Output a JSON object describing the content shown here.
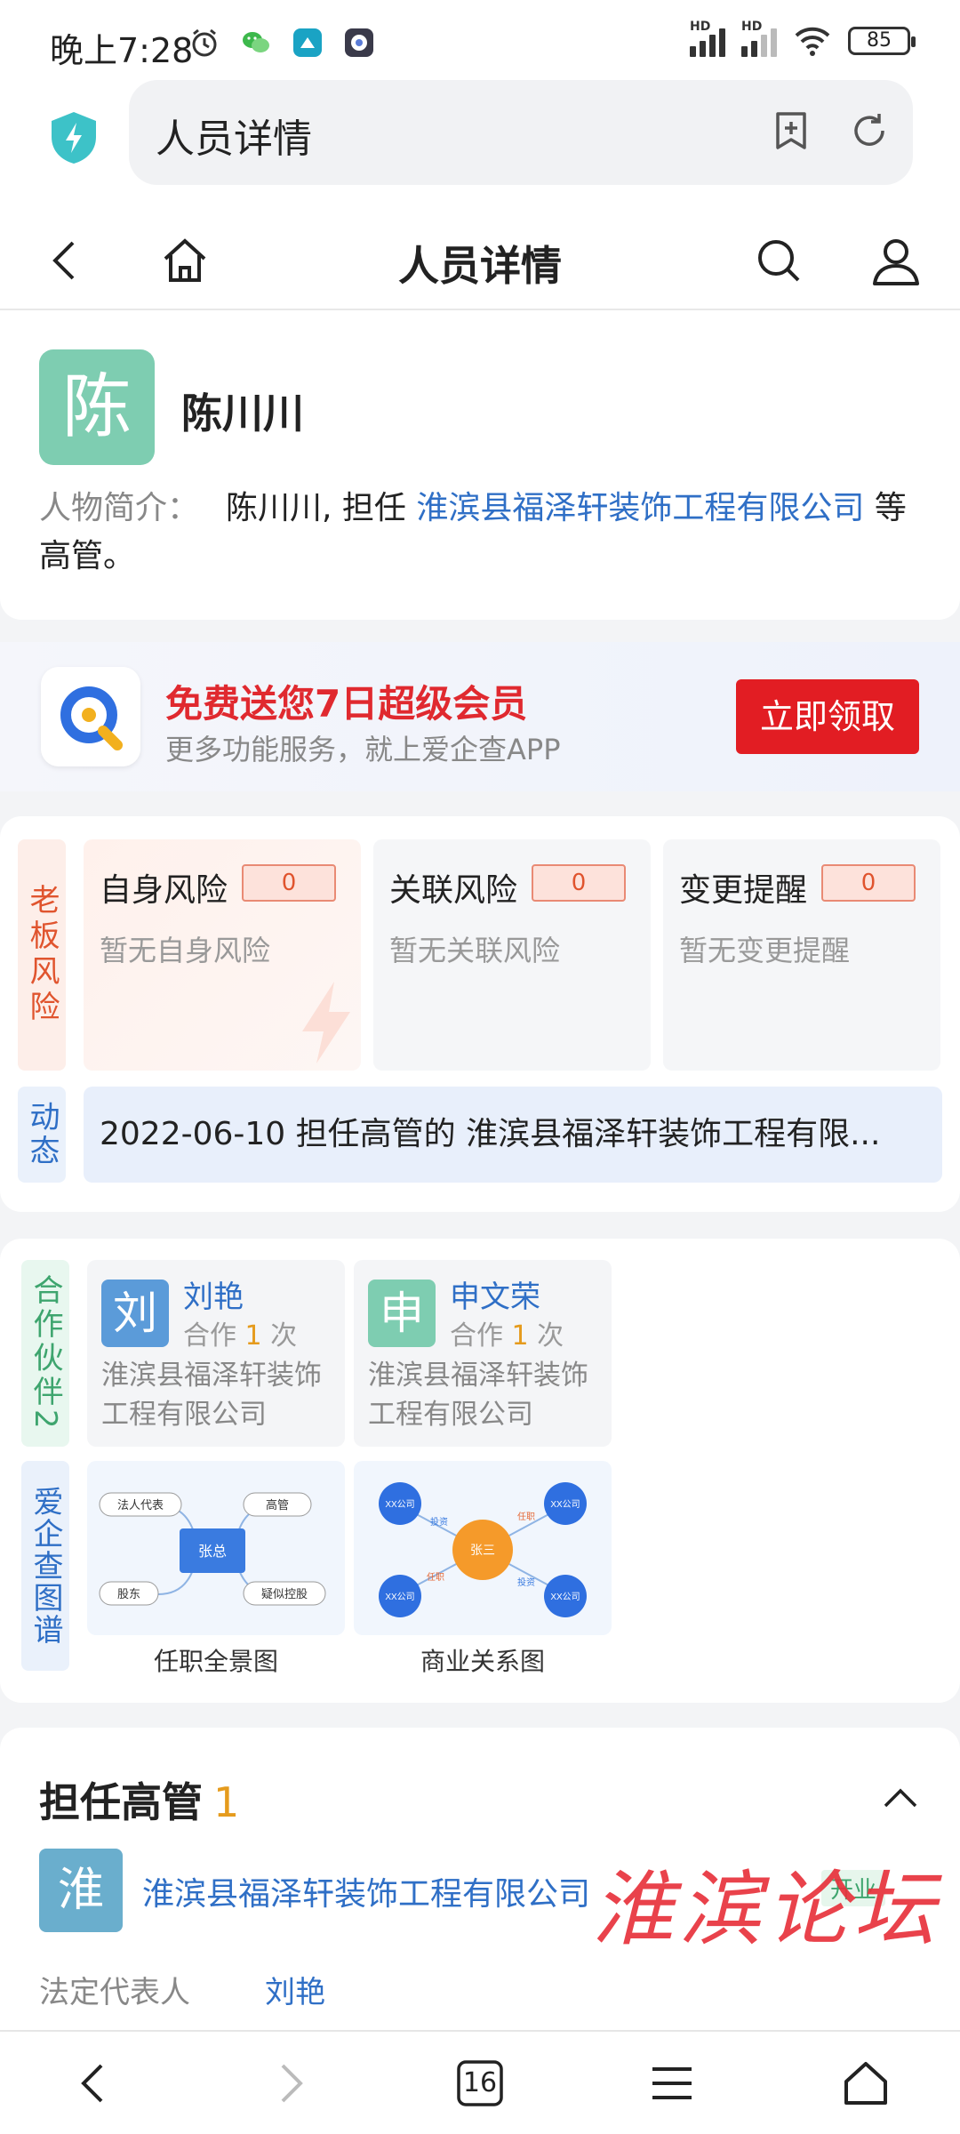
{
  "status_bar": {
    "time": "晚上7:28",
    "battery": "85",
    "icons": [
      "alarm-icon",
      "wechat-icon",
      "app-icon",
      "app-icon-2",
      "hd-signal-icon",
      "hd-signal-icon",
      "wifi-icon",
      "battery-icon"
    ]
  },
  "browser": {
    "url_title": "人员详情",
    "tab_count": "16"
  },
  "header": {
    "title": "人员详情"
  },
  "profile": {
    "avatar_char": "陈",
    "name": "陈川川",
    "intro_label": "人物简介：",
    "intro_prefix": "陈川川, 担任 ",
    "intro_company": "淮滨县福泽轩装饰工程有限公司",
    "intro_suffix": " 等高管。"
  },
  "promo": {
    "title": "免费送您7日超级会员",
    "subtitle": "更多功能服务，就上爱企查APP",
    "button": "立即领取"
  },
  "risk": {
    "tab_label": "老板风险",
    "items": [
      {
        "label": "自身风险",
        "count": "0",
        "desc": "暂无自身风险"
      },
      {
        "label": "关联风险",
        "count": "0",
        "desc": "暂无关联风险"
      },
      {
        "label": "变更提醒",
        "count": "0",
        "desc": "暂无变更提醒"
      }
    ],
    "dynamic_label": "动态",
    "dynamic_text": "2022-06-10  担任高管的 淮滨县福泽轩装饰工程有限..."
  },
  "partners": {
    "tab_label": "合作伙伴2",
    "items": [
      {
        "avatar_char": "刘",
        "name": "刘艳",
        "coop_prefix": "合作 ",
        "coop_num": "1",
        "coop_suffix": " 次",
        "company": "淮滨县福泽轩装饰工程有限公司",
        "color": "#5b9bd9"
      },
      {
        "avatar_char": "申",
        "name": "申文荣",
        "coop_prefix": "合作 ",
        "coop_num": "1",
        "coop_suffix": " 次",
        "company": "淮滨县福泽轩装饰工程有限公司",
        "color": "#7ecdb1"
      }
    ],
    "graph_tab_label": "爱企查图谱",
    "graphs": [
      {
        "caption": "任职全景图",
        "center": "张总",
        "nodes": [
          "法人代表",
          "高管",
          "股东",
          "疑似控股"
        ]
      },
      {
        "caption": "商业关系图",
        "center": "张三",
        "nodes": [
          "XX公司",
          "XX公司",
          "XX公司",
          "XX公司"
        ],
        "edges": [
          "投资",
          "任职",
          "任职",
          "投资"
        ]
      }
    ]
  },
  "executive": {
    "title": "担任高管",
    "count": "1",
    "avatar_char": "淮",
    "company": "淮滨县福泽轩装饰工程有限公司",
    "badge": "开业",
    "watermark": "淮滨论坛",
    "legal_label": "法定代表人",
    "legal_value": "刘艳"
  },
  "colors": {
    "accent_blue": "#2f6fc6",
    "promo_red": "#e21d23",
    "count_orange": "#e59b1d"
  }
}
